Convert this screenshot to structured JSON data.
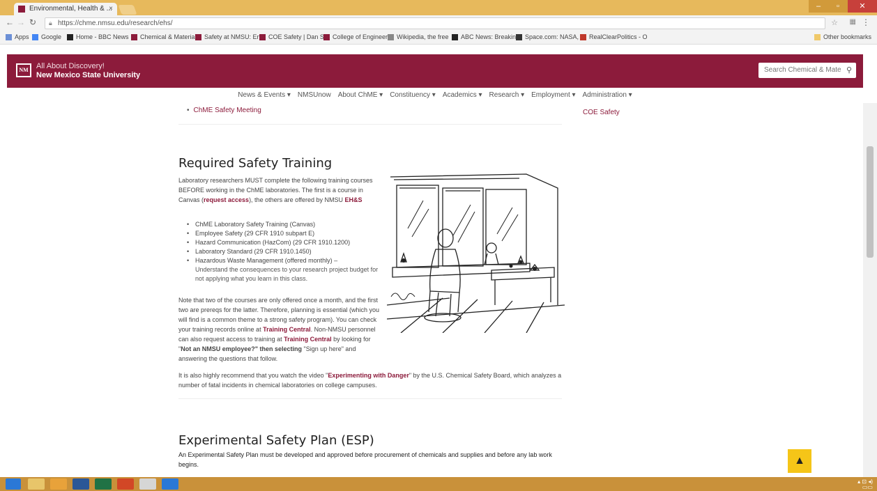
{
  "browser": {
    "tab_title": "Environmental, Health & ...",
    "tab_close": "×",
    "url": "https://chme.nmsu.edu/research/ehs/",
    "bookmarks": [
      {
        "label": "Apps",
        "color": "#6b8fd6"
      },
      {
        "label": "Google",
        "color": "#4285f4"
      },
      {
        "label": "Home - BBC News",
        "color": "#222222"
      },
      {
        "label": "Chemical & Materia",
        "color": "#8c1b3b"
      },
      {
        "label": "Safety at NMSU: En",
        "color": "#8c1b3b"
      },
      {
        "label": "COE Safety | Dan Sh",
        "color": "#8c1b3b"
      },
      {
        "label": "College of Engineer",
        "color": "#8c1b3b"
      },
      {
        "label": "Wikipedia, the free",
        "color": "#888888"
      },
      {
        "label": "ABC News: Breaking",
        "color": "#222222"
      },
      {
        "label": "Space.com: NASA, S",
        "color": "#333333"
      },
      {
        "label": "RealClearPolitics - O",
        "color": "#c0392b"
      }
    ],
    "other_bookmarks": "Other bookmarks"
  },
  "site": {
    "tagline": "All About Discovery!",
    "university": "New Mexico State University",
    "logo_text": "NM",
    "search_placeholder": "Search Chemical & Mate",
    "nav": [
      "News & Events ▾",
      "NMSUnow",
      "About ChME ▾",
      "Constituency ▾",
      "Academics ▾",
      "Research ▾",
      "Employment ▾",
      "Administration ▾"
    ]
  },
  "content": {
    "prev_item": "ChME Safety Meeting",
    "side_link": "COE Safety",
    "training": {
      "heading": "Required Safety Training",
      "intro_1": "Laboratory researchers MUST complete the following training courses BEFORE working in the ChME laboratories. The first is a course in Canvas (",
      "request_access": "request access",
      "intro_2": "), the others are offered by NMSU ",
      "ehs": "EH&S",
      "courses": [
        "ChME Laboratory Safety Training (Canvas)",
        "Employee Safety (29 CFR 1910 subpart E)",
        "Hazard Communication (HazCom) (29 CFR 1910.1200)",
        "Laboratory Standard (29 CFR 1910.1450)",
        "Hazardous Waste Management (offered monthly) –"
      ],
      "course_note": "Understand the consequences to your research project budget for not applying what you learn in this class.",
      "para2_1": "Note that two of the courses are only offered once a month, and the first two are prereqs for the latter. Therefore, planning is essential (which you will find is a common theme to a strong safety program). You can check your training records online at ",
      "training_central": "Training Central",
      "para2_2": ". Non-NMSU personnel can also request access to training at ",
      "para2_3": " by looking for \"",
      "not_nmsu": "Not an NMSU employee?\" then selecting",
      "para2_4": " \"Sign up here\" and answering the questions that follow.",
      "para3_1": "It is also highly recommend that you watch the video \"",
      "video_link": "Experimenting with Danger",
      "para3_2": "\" by the U.S. Chemical Safety Board, which analyzes a number of fatal incidents in chemical laboratories on college campuses."
    },
    "esp": {
      "heading": "Experimental Safety Plan (ESP)",
      "text": "An Experimental Safety Plan must be developed and approved before procurement of chemicals and supplies and before any lab work begins."
    }
  },
  "back_to_top": "▲",
  "colors": {
    "brand": "#8c1b3b",
    "accent": "#f5c518",
    "taskbar": "#c9913a"
  }
}
